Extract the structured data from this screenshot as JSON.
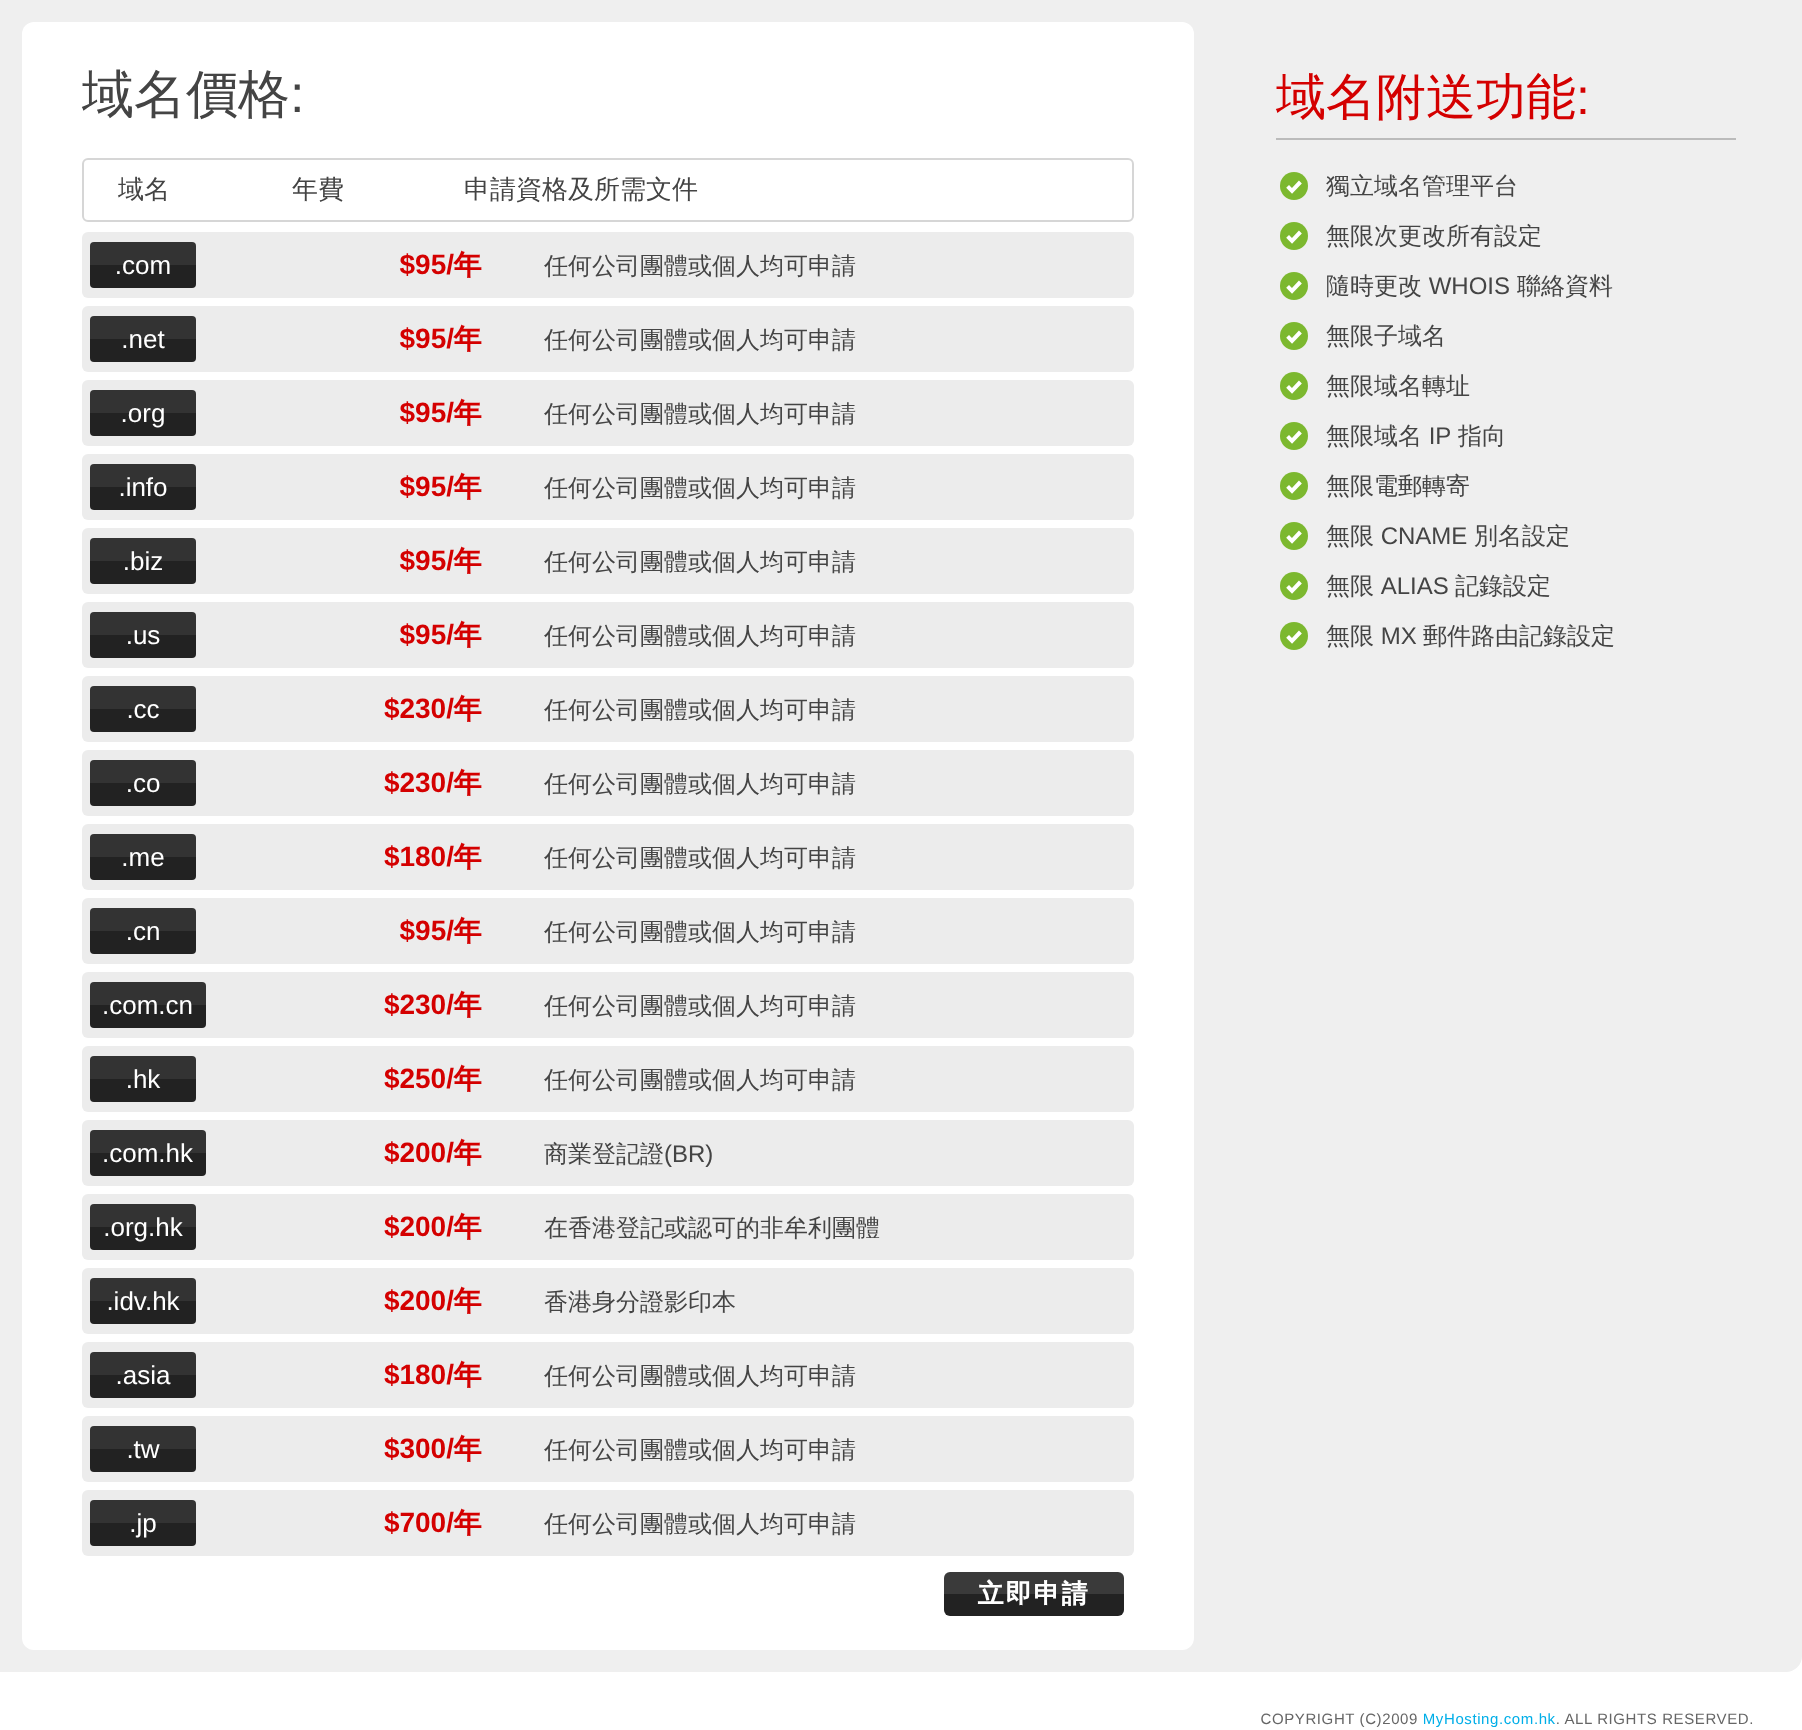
{
  "pricing": {
    "title": "域名價格:",
    "columns": [
      "域名",
      "年費",
      "申請資格及所需文件"
    ],
    "rows": [
      {
        "domain": ".com",
        "price": "$95/年",
        "requirement": "任何公司團體或個人均可申請"
      },
      {
        "domain": ".net",
        "price": "$95/年",
        "requirement": "任何公司團體或個人均可申請"
      },
      {
        "domain": ".org",
        "price": "$95/年",
        "requirement": "任何公司團體或個人均可申請"
      },
      {
        "domain": ".info",
        "price": "$95/年",
        "requirement": "任何公司團體或個人均可申請"
      },
      {
        "domain": ".biz",
        "price": "$95/年",
        "requirement": "任何公司團體或個人均可申請"
      },
      {
        "domain": ".us",
        "price": "$95/年",
        "requirement": "任何公司團體或個人均可申請"
      },
      {
        "domain": ".cc",
        "price": "$230/年",
        "requirement": "任何公司團體或個人均可申請"
      },
      {
        "domain": ".co",
        "price": "$230/年",
        "requirement": "任何公司團體或個人均可申請"
      },
      {
        "domain": ".me",
        "price": "$180/年",
        "requirement": "任何公司團體或個人均可申請"
      },
      {
        "domain": ".cn",
        "price": "$95/年",
        "requirement": "任何公司團體或個人均可申請"
      },
      {
        "domain": ".com.cn",
        "price": "$230/年",
        "requirement": "任何公司團體或個人均可申請"
      },
      {
        "domain": ".hk",
        "price": "$250/年",
        "requirement": "任何公司團體或個人均可申請"
      },
      {
        "domain": ".com.hk",
        "price": "$200/年",
        "requirement": "商業登記證(BR)"
      },
      {
        "domain": ".org.hk",
        "price": "$200/年",
        "requirement": "在香港登記或認可的非牟利團體"
      },
      {
        "domain": ".idv.hk",
        "price": "$200/年",
        "requirement": "香港身分證影印本"
      },
      {
        "domain": ".asia",
        "price": "$180/年",
        "requirement": "任何公司團體或個人均可申請"
      },
      {
        "domain": ".tw",
        "price": "$300/年",
        "requirement": "任何公司團體或個人均可申請"
      },
      {
        "domain": ".jp",
        "price": "$700/年",
        "requirement": "任何公司團體或個人均可申請"
      }
    ],
    "apply_button": "立即申請"
  },
  "features": {
    "title": "域名附送功能:",
    "items": [
      "獨立域名管理平台",
      "無限次更改所有設定",
      "隨時更改 WHOIS 聯絡資料",
      "無限子域名",
      "無限域名轉址",
      "無限域名 IP 指向",
      "無限電郵轉寄",
      "無限 CNAME 別名設定",
      "無限 ALIAS 記錄設定",
      "無限 MX 郵件路由記錄設定"
    ]
  },
  "footer": {
    "prefix": "COPYRIGHT (C)2009 ",
    "link": "MyHosting.com.hk",
    "suffix": ". ALL RIGHTS RESERVED."
  }
}
